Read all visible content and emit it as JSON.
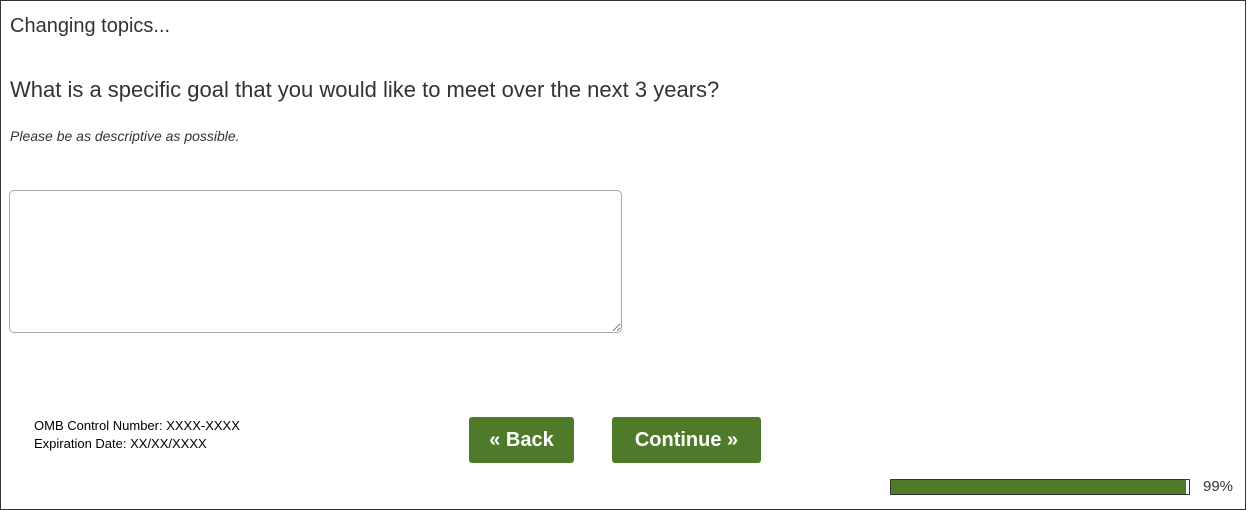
{
  "survey": {
    "intro": "Changing topics...",
    "question": "What is a specific goal that you would like to meet over the next 3 years?",
    "instruction": "Please be as descriptive as possible.",
    "answer_value": ""
  },
  "footer": {
    "omb_control": "OMB Control Number: XXXX-XXXX",
    "expiration": "Expiration Date: XX/XX/XXXX"
  },
  "nav": {
    "back_label": "« Back",
    "continue_label": "Continue »"
  },
  "progress": {
    "percent_value": 0.99,
    "label": "99%"
  },
  "colors": {
    "button_bg": "#4e7a2a",
    "text": "#333333",
    "progress_fill": "#4e7a2a"
  }
}
